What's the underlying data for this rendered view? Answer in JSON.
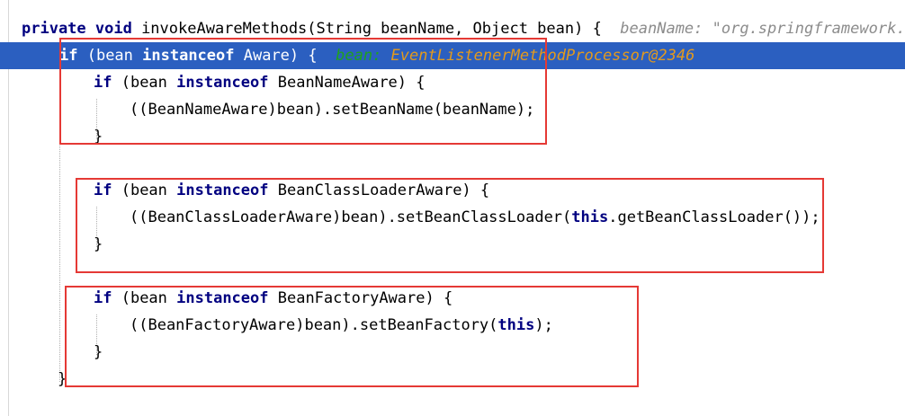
{
  "editor": {
    "lines": [
      {
        "tokens": [
          {
            "text": "private void ",
            "cls": "kw"
          },
          {
            "text": "invokeAwareMethods(String beanName, Object bean) {",
            "cls": "plain"
          }
        ],
        "hint": "beanName: \"org.springframework.c"
      },
      {
        "tokens": [
          {
            "text": "if",
            "cls": "kw"
          },
          {
            "text": " (bean ",
            "cls": "plain"
          },
          {
            "text": "instanceof",
            "cls": "kw"
          },
          {
            "text": " Aware) {",
            "cls": "plain"
          }
        ],
        "debug_name": "bean:",
        "debug_value": "EventListenerMethodProcessor@2346"
      },
      {
        "tokens": [
          {
            "text": "if",
            "cls": "kw"
          },
          {
            "text": " (bean ",
            "cls": "plain"
          },
          {
            "text": "instanceof",
            "cls": "kw"
          },
          {
            "text": " BeanNameAware) {",
            "cls": "plain"
          }
        ]
      },
      {
        "tokens": [
          {
            "text": "((BeanNameAware)bean).setBeanName(beanName);",
            "cls": "plain"
          }
        ]
      },
      {
        "tokens": [
          {
            "text": "}",
            "cls": "plain"
          }
        ]
      },
      {
        "tokens": [
          {
            "text": "if",
            "cls": "kw"
          },
          {
            "text": " (bean ",
            "cls": "plain"
          },
          {
            "text": "instanceof",
            "cls": "kw"
          },
          {
            "text": " BeanClassLoaderAware) {",
            "cls": "plain"
          }
        ]
      },
      {
        "tokens": [
          {
            "text": "((BeanClassLoaderAware)bean).setBeanClassLoader(",
            "cls": "plain"
          },
          {
            "text": "this",
            "cls": "kw"
          },
          {
            "text": ".getBeanClassLoader());",
            "cls": "plain"
          }
        ]
      },
      {
        "tokens": [
          {
            "text": "}",
            "cls": "plain"
          }
        ]
      },
      {
        "tokens": [
          {
            "text": "if",
            "cls": "kw"
          },
          {
            "text": " (bean ",
            "cls": "plain"
          },
          {
            "text": "instanceof",
            "cls": "kw"
          },
          {
            "text": " BeanFactoryAware) {",
            "cls": "plain"
          }
        ]
      },
      {
        "tokens": [
          {
            "text": "((BeanFactoryAware)bean).setBeanFactory(",
            "cls": "plain"
          },
          {
            "text": "this",
            "cls": "kw"
          },
          {
            "text": ");",
            "cls": "plain"
          }
        ]
      },
      {
        "tokens": [
          {
            "text": "}",
            "cls": "plain"
          }
        ]
      },
      {
        "tokens": [
          {
            "text": "}",
            "cls": "plain"
          }
        ]
      }
    ]
  },
  "colors": {
    "keyword": "#000080",
    "current_line": "#2b5fc0",
    "annotation_box": "#e53935",
    "debug_name": "#1fa11f",
    "debug_value": "#e39a1d",
    "hint": "#8c8c8c"
  }
}
